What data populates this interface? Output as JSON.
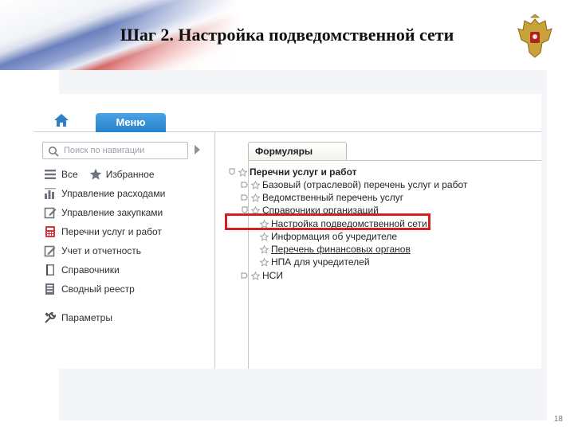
{
  "slide": {
    "title": "Шаг 2. Настройка подведомственной сети",
    "page_number": "18"
  },
  "app": {
    "menu_tab_label": "Меню",
    "search": {
      "placeholder": "Поиск по навигации"
    },
    "nav": {
      "all": "Все",
      "favorites": "Избранное",
      "items": [
        {
          "label": "Управление расходами",
          "icon": "chart-bars-icon"
        },
        {
          "label": "Управление закупками",
          "icon": "edit-doc-icon"
        },
        {
          "label": "Перечни услуг и работ",
          "icon": "calculator-icon"
        },
        {
          "label": "Учет и отчетность",
          "icon": "pencil-doc-icon"
        },
        {
          "label": "Справочники",
          "icon": "book-icon"
        },
        {
          "label": "Сводный реестр",
          "icon": "register-icon"
        }
      ],
      "settings": "Параметры"
    },
    "forms_tab_label": "Формуляры",
    "tree": {
      "root": "Перечни услуг и работ",
      "basic_list": "Базовый (отраслевой) перечень услуг и работ",
      "department_list": "Ведомственный перечень услуг",
      "org_directories": "Справочники организаций",
      "org_children": [
        "Настройка подведомственной сети",
        "Информация об учредителе",
        "Перечень финансовых органов",
        "НПА для учредителей"
      ],
      "nsi": "НСИ"
    }
  },
  "colors": {
    "menu_tab": "#1f79c5",
    "highlight": "#d51e1e"
  }
}
